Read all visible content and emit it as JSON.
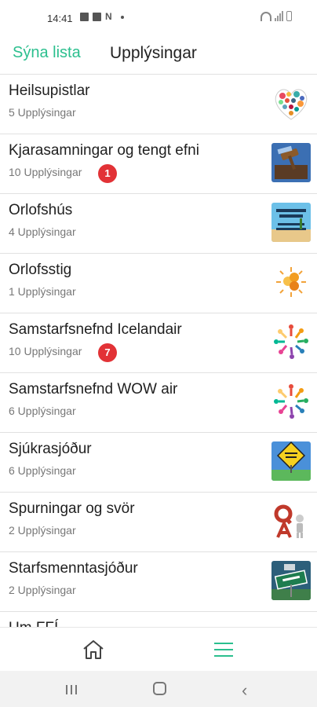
{
  "status_bar": {
    "time": "14:41",
    "icons": [
      "photo-icon",
      "message-icon",
      "n-icon",
      "wifi-icon",
      "signal-icon",
      "battery-icon"
    ]
  },
  "header": {
    "show_list": "Sýna lista",
    "title": "Upplýsingar"
  },
  "colors": {
    "accent": "#2bbf8e",
    "badge": "#e23236",
    "divider": "#e1e1e1"
  },
  "list": [
    {
      "title": "Heilsupistlar",
      "subtitle": "5 Upplýsingar",
      "badge": null,
      "thumb": "heart-collage-icon"
    },
    {
      "title": "Kjarasamningar og tengt efni",
      "subtitle": "10 Upplýsingar",
      "badge": "1",
      "thumb": "gavel-icon"
    },
    {
      "title": "Orlofshús",
      "subtitle": "4 Upplýsingar",
      "badge": null,
      "thumb": "keep-calm-icon"
    },
    {
      "title": "Orlofsstig",
      "subtitle": "1 Upplýsingar",
      "badge": null,
      "thumb": "numbers-sun-icon"
    },
    {
      "title": "Samstarfsnefnd Icelandair",
      "subtitle": "10 Upplýsingar",
      "badge": "7",
      "thumb": "people-circle-icon"
    },
    {
      "title": "Samstarfsnefnd WOW air",
      "subtitle": "6 Upplýsingar",
      "badge": null,
      "thumb": "people-circle-icon"
    },
    {
      "title": "Sjúkrasjóður",
      "subtitle": "6 Upplýsingar",
      "badge": null,
      "thumb": "safety-sign-icon"
    },
    {
      "title": "Spurningar og svör",
      "subtitle": "2 Upplýsingar",
      "badge": null,
      "thumb": "qa-figure-icon"
    },
    {
      "title": "Starfsmenntasjóður",
      "subtitle": "2 Upplýsingar",
      "badge": null,
      "thumb": "education-sign-icon"
    },
    {
      "title": "Um FFÍ",
      "subtitle": "",
      "badge": null,
      "thumb": "partial-icon"
    }
  ],
  "bottom_nav": {
    "items": [
      "home-icon",
      "menu-icon"
    ],
    "active": "menu-icon"
  },
  "system_nav": {
    "items": [
      "recent-apps-icon",
      "home-button-icon",
      "back-icon"
    ]
  }
}
